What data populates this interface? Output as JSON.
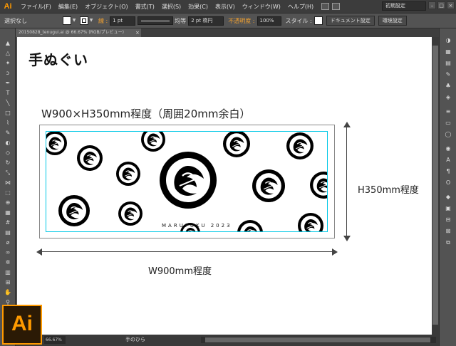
{
  "app": {
    "logo": "Ai"
  },
  "menubar": {
    "items": [
      "ファイル(F)",
      "編集(E)",
      "オブジェクト(O)",
      "書式(T)",
      "選択(S)",
      "効果(C)",
      "表示(V)",
      "ウィンドウ(W)",
      "ヘルプ(H)"
    ],
    "workspace": "初期設定"
  },
  "control_bar": {
    "selection": "選択なし",
    "stroke_label": "線 :",
    "stroke_weight": "1 pt",
    "line_style": "均等",
    "brush": "2 pt 楕円",
    "opacity_label": "不透明度 :",
    "opacity": "100%",
    "style_label": "スタイル :",
    "doc_settings": "ドキュメント設定",
    "prefs": "環境設定"
  },
  "document": {
    "tab_title": "20150828_tenugui.ai @ 66.67% (RGB/プレビュー)",
    "zoom": "66.67%",
    "status": "手のひら"
  },
  "artwork": {
    "title": "手ぬぐい",
    "spec": "W900×H350mm程度（周囲20mm余白）",
    "width_label": "W900mm程度",
    "height_label": "H350mm程度",
    "brand": "MARUFUKU 2023"
  },
  "colors": {
    "accent": "#ff9a00",
    "bleed_guide": "#00c8e6",
    "opacity_label": "#f0a030"
  }
}
